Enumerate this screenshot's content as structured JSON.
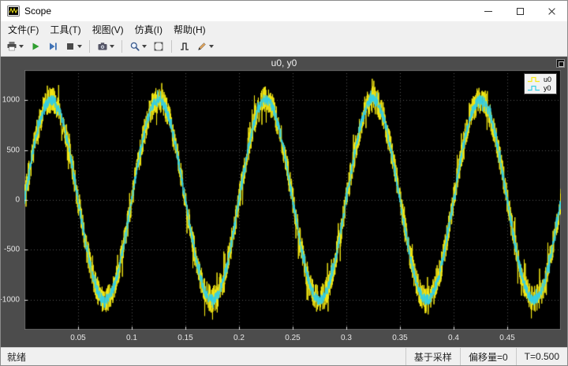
{
  "window": {
    "title": "Scope"
  },
  "menu": {
    "items": [
      {
        "name": "file",
        "label": "文件(F)"
      },
      {
        "name": "tools",
        "label": "工具(T)"
      },
      {
        "name": "view",
        "label": "视图(V)"
      },
      {
        "name": "simulation",
        "label": "仿真(I)"
      },
      {
        "name": "help",
        "label": "帮助(H)"
      }
    ]
  },
  "toolbar": {
    "items": [
      "print-icon",
      "run-icon",
      "step-forward-icon",
      "stop-icon",
      "snapshot-icon",
      "zoom-icon",
      "fit-to-view-icon",
      "trigger-icon",
      "style-icon"
    ]
  },
  "scope": {
    "title": "u0, y0"
  },
  "legend": {
    "entries": [
      {
        "label": "u0",
        "color": "#f5e914"
      },
      {
        "label": "y0",
        "color": "#35cfe4"
      }
    ]
  },
  "status": {
    "ready": "就绪",
    "cells": [
      {
        "name": "sample-mode",
        "label": "基于采样"
      },
      {
        "name": "offset",
        "label": "偏移量=0"
      },
      {
        "name": "time",
        "label": "T=0.500"
      }
    ]
  },
  "chart_data": {
    "type": "line",
    "title": "u0, y0",
    "xlabel": "",
    "ylabel": "",
    "xlim": [
      0,
      0.5
    ],
    "ylim": [
      -1300,
      1300
    ],
    "x_ticks": [
      0.05,
      0.1,
      0.15,
      0.2,
      0.25,
      0.3,
      0.35,
      0.4,
      0.45
    ],
    "x_tick_labels": [
      "0.05",
      "0.1",
      "0.15",
      "0.2",
      "0.25",
      "0.3",
      "0.35",
      "0.4",
      "0.45"
    ],
    "y_ticks": [
      1000,
      500,
      0,
      -500,
      -1000
    ],
    "y_tick_labels": [
      "1000",
      "500",
      "0",
      "-500",
      "-1000"
    ],
    "grid": true,
    "background": "#000000",
    "grid_color": "#555555",
    "legend_position": "top-right",
    "series": [
      {
        "name": "u0",
        "color": "#f5e914",
        "waveform": "noisy-sine",
        "amplitude": 1000,
        "frequency_hz": 10,
        "phase": 0,
        "noise_amplitude": 140
      },
      {
        "name": "y0",
        "color": "#35cfe4",
        "waveform": "noisy-sine",
        "amplitude": 1000,
        "frequency_hz": 10,
        "phase": 0,
        "noise_amplitude": 55
      }
    ],
    "time_offset": 0,
    "time_span": 0.5
  }
}
